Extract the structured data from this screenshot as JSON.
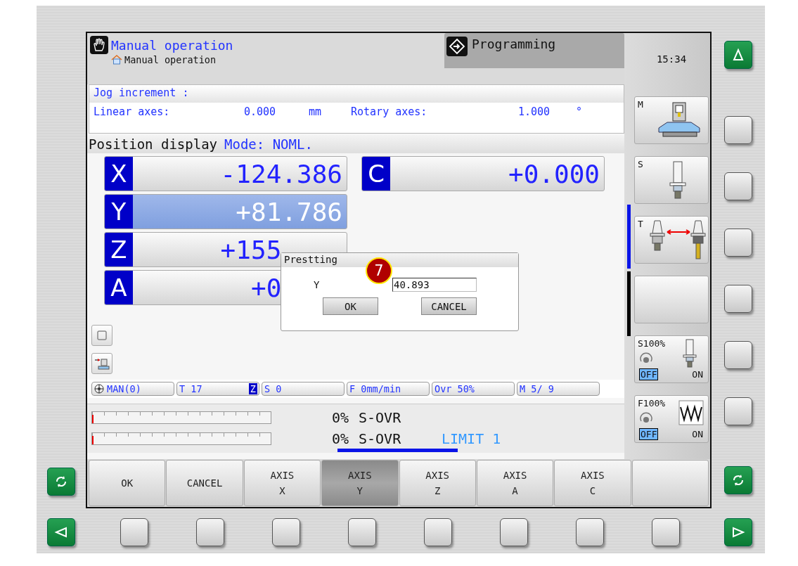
{
  "header": {
    "mode_title": "Manual operation",
    "breadcrumb": "Manual operation",
    "other_mode": "Programming"
  },
  "jog_increment": {
    "title": "Jog increment :",
    "linear_label": "Linear axes:",
    "linear_value": "0.000",
    "linear_unit": "mm",
    "rotary_label": "Rotary axes:",
    "rotary_value": "1.000",
    "rotary_unit": "°"
  },
  "position_display": {
    "title": "Position display",
    "mode": "Mode: NOML."
  },
  "axes": [
    {
      "axis": "X",
      "value": "-124.386",
      "selected": false
    },
    {
      "axis": "Y",
      "value": "+81.786",
      "selected": true
    },
    {
      "axis": "Z",
      "value": "+155",
      "selected": false
    },
    {
      "axis": "A",
      "value": "+0",
      "selected": false
    },
    {
      "axis": "C",
      "value": "+0.000",
      "selected": false
    }
  ],
  "dialog": {
    "title": "Prestting",
    "field_label": "Y",
    "field_value": "40.893",
    "buttons": [
      "OK",
      "CANCEL"
    ],
    "badge": "7"
  },
  "status_bar": [
    {
      "label": "MAN(0)",
      "kind": "mode"
    },
    {
      "label": "T 17",
      "kind": "tool",
      "tag": "Z"
    },
    {
      "label": "S 0",
      "kind": "text"
    },
    {
      "label": "F 0mm/min",
      "kind": "text"
    },
    {
      "label": "Ovr 50%",
      "kind": "text"
    },
    {
      "label": "M 5/ 9",
      "kind": "text"
    }
  ],
  "gauges": [
    {
      "level": 0,
      "reading": "0%",
      "label": "S-OVR"
    },
    {
      "level": 0,
      "reading": "0%",
      "label": "S-OVR",
      "note": "LIMIT 1"
    }
  ],
  "side_panel": {
    "time": "15:34",
    "buttons": [
      {
        "kind": "machine",
        "label": "M"
      },
      {
        "kind": "spindle",
        "label": "S"
      },
      {
        "kind": "tool-change",
        "label": "T"
      },
      {
        "kind": "blank"
      },
      {
        "kind": "override-spindle",
        "label": "S100%",
        "off_label": "OFF",
        "on_label": "ON",
        "on": false
      },
      {
        "kind": "override-feed",
        "label": "F100%",
        "off_label": "OFF",
        "on_label": "ON",
        "on": false
      }
    ]
  },
  "softkeys": [
    {
      "lines": [
        "OK"
      ],
      "selected": false
    },
    {
      "lines": [
        "CANCEL"
      ],
      "selected": false
    },
    {
      "lines": [
        "AXIS",
        "X"
      ],
      "selected": false
    },
    {
      "lines": [
        "AXIS",
        "Y"
      ],
      "selected": true
    },
    {
      "lines": [
        "AXIS",
        "Z"
      ],
      "selected": false
    },
    {
      "lines": [
        "AXIS",
        "A"
      ],
      "selected": false
    },
    {
      "lines": [
        "AXIS",
        "C"
      ],
      "selected": false
    },
    {
      "selected": false
    }
  ]
}
